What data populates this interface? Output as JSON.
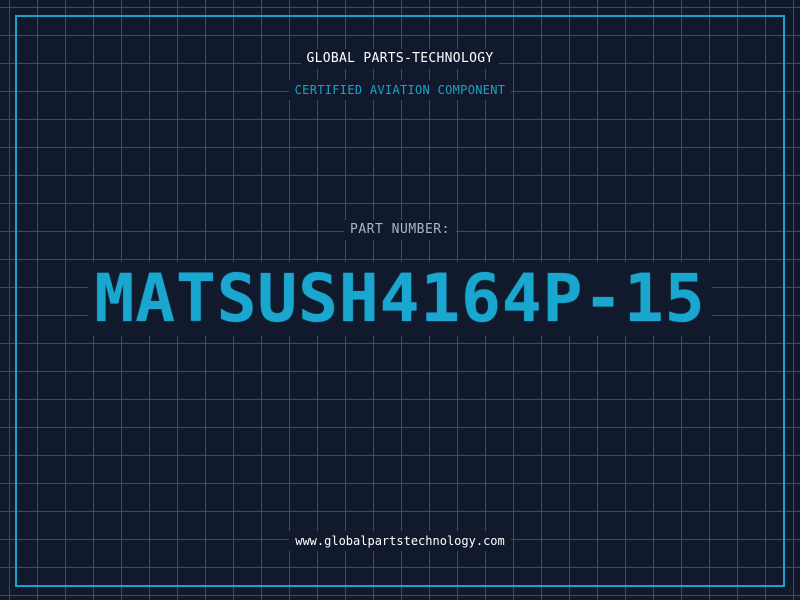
{
  "header": {
    "company": "GLOBAL PARTS-TECHNOLOGY",
    "subtitle": "CERTIFIED AVIATION COMPONENT"
  },
  "main": {
    "part_label": "PART NUMBER:",
    "part_number": "MATSUSH4164P-15"
  },
  "footer": {
    "website": "www.globalpartstechnology.com"
  },
  "colors": {
    "background": "#111a2d",
    "grid": "#1b5b6b",
    "accent": "#1ba2c8",
    "text_primary": "#ffffff",
    "text_muted": "#a9b6c6"
  }
}
